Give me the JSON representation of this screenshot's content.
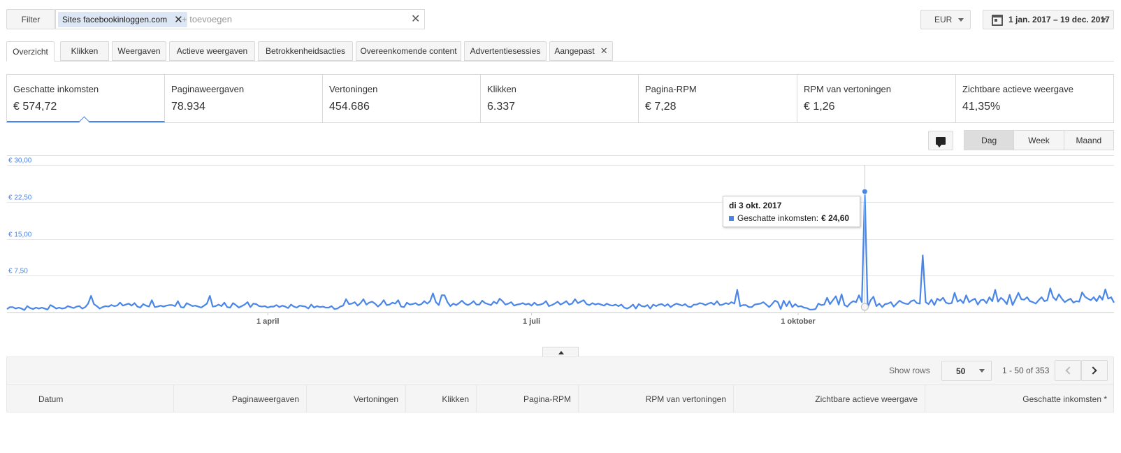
{
  "filter": {
    "button_label": "Filter",
    "chip_prefix": "Sites",
    "chip_value": "facebookinloggen.com",
    "add_placeholder": "+ toevoegen"
  },
  "currency": "EUR",
  "date_range": "1 jan. 2017 – 19 dec. 2017",
  "tabs": [
    {
      "label": "Overzicht",
      "active": true
    },
    {
      "label": "Klikken"
    },
    {
      "label": "Weergaven"
    },
    {
      "label": "Actieve weergaven"
    },
    {
      "label": "Betrokkenheidsacties"
    },
    {
      "label": "Overeenkomende content"
    },
    {
      "label": "Advertentiesessies"
    },
    {
      "label": "Aangepast",
      "closable": true
    }
  ],
  "metrics": [
    {
      "label": "Geschatte inkomsten",
      "value": "€ 574,72",
      "selected": true
    },
    {
      "label": "Paginaweergaven",
      "value": "78.934"
    },
    {
      "label": "Vertoningen",
      "value": "454.686"
    },
    {
      "label": "Klikken",
      "value": "6.337"
    },
    {
      "label": "Pagina-RPM",
      "value": "€ 7,28"
    },
    {
      "label": "RPM van vertoningen",
      "value": "€ 1,26"
    },
    {
      "label": "Zichtbare actieve weergave",
      "value": "41,35%"
    }
  ],
  "granularity": [
    "Dag",
    "Week",
    "Maand"
  ],
  "granularity_active": "Dag",
  "tooltip": {
    "date": "di 3 okt. 2017",
    "series": "Geschatte inkomsten:",
    "value": "€ 24,60"
  },
  "colors": {
    "accent": "#4a86e8",
    "axis_label": "#4a86e8"
  },
  "chart_data": {
    "type": "line",
    "y_ticks": [
      "€ 30,00",
      "€ 22,50",
      "€ 15,00",
      "€ 7,50"
    ],
    "y_tick_values": [
      30,
      22.5,
      15,
      7.5
    ],
    "ylim": [
      0,
      30
    ],
    "x_ticks": [
      {
        "label": "1 april",
        "day": 90
      },
      {
        "label": "1 juli",
        "day": 181
      },
      {
        "label": "1 oktober",
        "day": 273
      }
    ],
    "x_range": [
      "2017-01-01",
      "2017-12-19"
    ],
    "grid": true,
    "series": [
      {
        "name": "Geschatte inkomsten",
        "values": [
          0.7,
          1.1,
          1.1,
          0.8,
          1.0,
          0.8,
          0.5,
          1.3,
          0.9,
          0.7,
          1.0,
          0.8,
          1.0,
          0.8,
          0.6,
          1.5,
          1.2,
          0.8,
          1.0,
          0.8,
          0.9,
          1.3,
          1.1,
          0.9,
          1.2,
          1.3,
          0.8,
          1.1,
          1.8,
          3.4,
          1.7,
          1.3,
          0.8,
          1.1,
          1.3,
          1.2,
          1.5,
          1.3,
          1.4,
          2.0,
          1.4,
          1.6,
          1.8,
          1.4,
          1.9,
          1.2,
          1.0,
          1.7,
          1.4,
          1.2,
          2.5,
          1.1,
          1.2,
          1.4,
          1.2,
          1.4,
          1.5,
          1.5,
          1.3,
          2.3,
          1.1,
          1.0,
          1.9,
          1.6,
          1.3,
          1.4,
          1.2,
          1.0,
          1.4,
          1.8,
          3.4,
          1.2,
          1.3,
          1.6,
          1.3,
          2.0,
          1.1,
          1.0,
          1.9,
          1.5,
          1.0,
          1.3,
          1.6,
          2.1,
          1.1,
          1.8,
          1.7,
          1.3,
          1.2,
          1.3,
          1.0,
          1.2,
          1.2,
          1.5,
          1.1,
          1.4,
          1.2,
          0.9,
          1.6,
          1.2,
          1.0,
          1.4,
          1.3,
          1.2,
          0.8,
          1.6,
          1.0,
          1.3,
          1.1,
          1.2,
          1.0,
          1.0,
          1.3,
          0.7,
          0.8,
          1.2,
          1.4,
          2.7,
          1.7,
          1.8,
          2.1,
          1.4,
          1.9,
          2.7,
          1.6,
          2.0,
          2.2,
          1.8,
          1.2,
          1.7,
          2.5,
          1.5,
          1.6,
          2.0,
          1.8,
          2.5,
          1.2,
          1.1,
          2.0,
          1.6,
          1.7,
          1.9,
          1.5,
          1.7,
          2.3,
          1.8,
          2.3,
          3.9,
          2.1,
          1.5,
          3.5,
          3.5,
          2.1,
          1.3,
          1.8,
          1.5,
          1.9,
          2.4,
          1.8,
          1.5,
          1.8,
          2.3,
          1.6,
          1.6,
          2.4,
          1.9,
          1.7,
          1.5,
          2.2,
          1.8,
          2.8,
          2.3,
          1.6,
          1.8,
          2.1,
          1.4,
          1.6,
          1.7,
          1.9,
          1.6,
          1.8,
          1.4,
          2.0,
          1.5,
          1.6,
          1.8,
          2.3,
          1.3,
          1.5,
          1.8,
          2.2,
          1.6,
          1.9,
          2.3,
          1.6,
          1.8,
          2.7,
          1.9,
          2.2,
          2.5,
          1.7,
          1.5,
          1.9,
          1.6,
          1.8,
          1.6,
          1.4,
          1.8,
          1.5,
          1.4,
          1.6,
          1.3,
          1.6,
          1.0,
          0.8,
          1.1,
          1.6,
          0.8,
          1.7,
          1.3,
          1.2,
          1.5,
          0.8,
          1.6,
          1.3,
          1.6,
          1.7,
          1.3,
          1.7,
          1.1,
          1.5,
          1.8,
          1.6,
          1.4,
          1.7,
          1.2,
          1.1,
          1.6,
          1.6,
          1.9,
          1.8,
          1.5,
          1.8,
          2.0,
          1.6,
          2.3,
          1.5,
          1.6,
          1.9,
          1.7,
          2.1,
          1.8,
          4.6,
          1.3,
          1.5,
          1.5,
          1.1,
          1.1,
          1.6,
          1.7,
          1.8,
          2.1,
          1.6,
          1.1,
          1.7,
          2.4,
          2.1,
          0.7,
          2.4,
          1.3,
          2.3,
          1.1,
          1.7,
          1.2,
          1.3,
          1.0,
          0.9,
          0.6,
          0.6,
          0.7,
          1.8,
          1.5,
          1.6,
          3.0,
          1.7,
          2.5,
          3.3,
          1.6,
          3.7,
          1.5,
          1.2,
          1.9,
          2.3,
          2.1,
          3.5,
          2.1,
          24.6,
          1.0,
          2.5,
          3.2,
          1.3,
          1.8,
          1.1,
          1.7,
          1.8,
          2.1,
          1.2,
          1.8,
          2.4,
          2.0,
          1.8,
          1.7,
          2.3,
          2.5,
          1.9,
          1.8,
          11.6,
          2.1,
          1.7,
          2.6,
          1.5,
          2.8,
          2.4,
          3.0,
          2.0,
          1.8,
          1.9,
          4.0,
          2.2,
          2.6,
          1.9,
          3.5,
          2.1,
          2.5,
          2.8,
          1.6,
          2.5,
          2.6,
          1.9,
          3.1,
          2.3,
          4.6,
          2.2,
          3.0,
          2.5,
          1.7,
          3.6,
          1.5,
          2.7,
          4.0,
          2.7,
          2.6,
          3.1,
          2.3,
          2.1,
          1.8,
          2.5,
          3.1,
          2.3,
          2.5,
          4.9,
          3.1,
          2.5,
          3.7,
          2.8,
          2.1,
          2.5,
          2.8,
          2.0,
          2.3,
          2.2,
          4.1,
          3.2,
          2.8,
          2.5,
          3.1,
          2.3,
          3.4,
          2.6,
          4.7,
          2.8,
          3.1,
          2.0
        ]
      }
    ]
  },
  "table": {
    "show_rows_label": "Show rows",
    "rows_value": "50",
    "page_range": "1 - 50 of 353",
    "columns": [
      "Datum",
      "Paginaweergaven",
      "Vertoningen",
      "Klikken",
      "Pagina-RPM",
      "RPM van vertoningen",
      "Zichtbare actieve weergave",
      "Geschatte inkomsten *"
    ]
  }
}
